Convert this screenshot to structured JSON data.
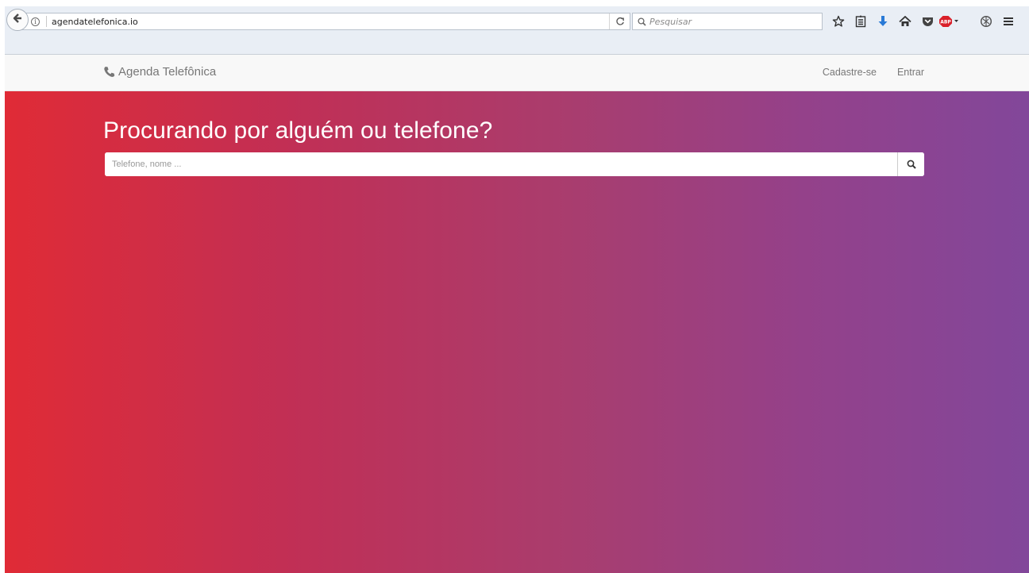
{
  "browser": {
    "url": "agendatelefonica.io",
    "search_placeholder": "Pesquisar",
    "icons": [
      "back-icon",
      "info-icon",
      "reload-icon",
      "search-icon",
      "star-icon",
      "reading-list-icon",
      "download-icon",
      "home-icon",
      "pocket-icon",
      "adblock-icon",
      "extension-icon",
      "menu-icon"
    ],
    "adblock_label": "ABP"
  },
  "navbar": {
    "brand": "Agenda Telefônica",
    "brand_icon": "phone-icon",
    "links": [
      {
        "label": "Cadastre-se"
      },
      {
        "label": "Entrar"
      }
    ]
  },
  "hero": {
    "title": "Procurando por alguém ou telefone?",
    "search_placeholder": "Telefone, nome ...",
    "search_button_icon": "search-icon",
    "gradient_colors": [
      "#e02b36",
      "#c12f55",
      "#a93d6e",
      "#94418a",
      "#82479a"
    ]
  }
}
